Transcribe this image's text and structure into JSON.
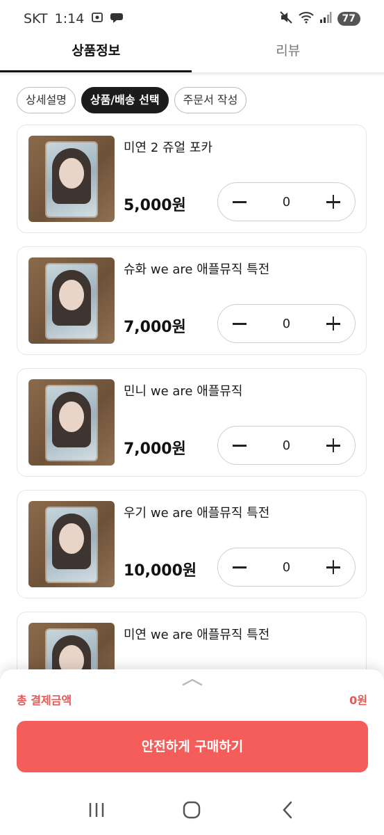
{
  "status_bar": {
    "carrier": "SKT",
    "time": "1:14",
    "battery": "77"
  },
  "tabs": [
    {
      "label": "상품정보",
      "active": true
    },
    {
      "label": "리뷰",
      "active": false
    }
  ],
  "chips": [
    {
      "label": "상세설명",
      "selected": false
    },
    {
      "label": "상품/배송 선택",
      "selected": true
    },
    {
      "label": "주문서 작성",
      "selected": false
    }
  ],
  "products": [
    {
      "name": "미연 2 쥬얼 포카",
      "price": "5,000원",
      "qty": "0"
    },
    {
      "name": "슈화 we are 애플뮤직 특전",
      "price": "7,000원",
      "qty": "0"
    },
    {
      "name": "민니 we are 애플뮤직",
      "price": "7,000원",
      "qty": "0"
    },
    {
      "name": "우기 we are 애플뮤직 특전",
      "price": "10,000원",
      "qty": "0"
    },
    {
      "name": "미연 we are 애플뮤직 특전",
      "price": "",
      "qty": ""
    }
  ],
  "summary": {
    "total_label": "총 결제금액",
    "total_value": "0원",
    "buy_label": "안전하게 구매하기"
  },
  "colors": {
    "accent": "#f45d5a",
    "total_text": "#e35a57",
    "chip_selected": "#1c1c1c"
  }
}
